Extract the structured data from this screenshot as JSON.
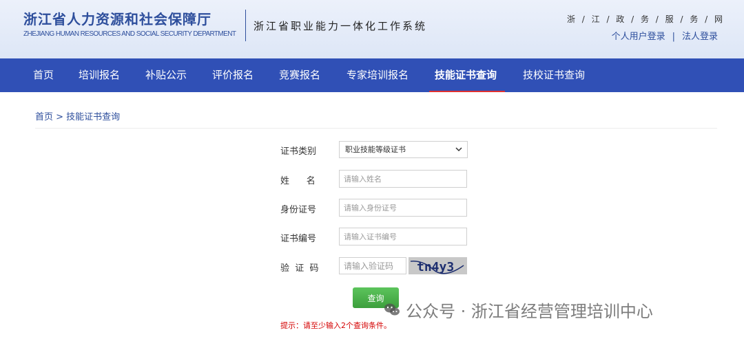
{
  "header": {
    "org_name": "浙江省人力资源和社会保障厅",
    "org_name_en": "ZHEJIANG HUMAN RESOURCES AND SOCIAL SECURITY DEPARTMENT",
    "system_name": "浙江省职业能力一体化工作系统",
    "gov_link": "浙 / 江 / 政 / 务 / 服 / 务 / 网",
    "personal_login": "个人用户登录",
    "separator": "|",
    "corporate_login": "法人登录"
  },
  "nav": {
    "items": [
      {
        "label": "首页"
      },
      {
        "label": "培训报名"
      },
      {
        "label": "补贴公示"
      },
      {
        "label": "评价报名"
      },
      {
        "label": "竞赛报名"
      },
      {
        "label": "专家培训报名"
      },
      {
        "label": "技能证书查询"
      },
      {
        "label": "技校证书查询"
      }
    ],
    "active": "技能证书查询"
  },
  "breadcrumb": "首页 > 技能证书查询",
  "form": {
    "cert_type_label": "证书类别",
    "cert_type_value": "职业技能等级证书",
    "name_label": "姓      名",
    "name_placeholder": "请输入姓名",
    "id_label": "身份证号",
    "id_placeholder": "请输入身份证号",
    "cert_no_label": "证书编号",
    "cert_no_placeholder": "请输入证书编号",
    "captcha_label": "验  证  码",
    "captcha_placeholder": "请输入验证码",
    "captcha_text": "tn4y3",
    "query_button": "查询",
    "tip": "提示：请至少输入2个查询条件。"
  },
  "watermark": {
    "text": "公众号 · 浙江省经营管理培训中心",
    "icon": "wechat-icon"
  },
  "colors": {
    "brand_blue": "#2d4e9c",
    "nav_blue": "#3050b6",
    "active_underline": "#e03030",
    "button_green": "#4caf50",
    "tip_red": "#d40000"
  }
}
